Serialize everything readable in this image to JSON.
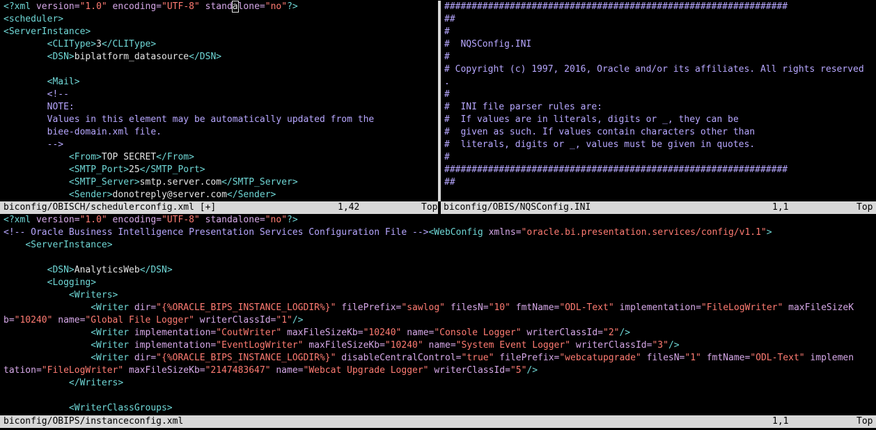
{
  "top_left": {
    "lines": [
      [
        {
          "c": "t",
          "v": "<?"
        },
        {
          "c": "t",
          "v": "xml "
        },
        {
          "c": "a",
          "v": "version="
        },
        {
          "c": "s",
          "v": "\"1.0\""
        },
        {
          "c": "a",
          "v": " encoding="
        },
        {
          "c": "s",
          "v": "\"UTF-8\""
        },
        {
          "c": "a",
          "v": " stand"
        },
        {
          "c": "cursor",
          "v": "a"
        },
        {
          "c": "a",
          "v": "lone="
        },
        {
          "c": "s",
          "v": "\"no\""
        },
        {
          "c": "t",
          "v": "?>"
        }
      ],
      [
        {
          "c": "t",
          "v": "<scheduler>"
        }
      ],
      [
        {
          "c": "t",
          "v": "<ServerInstance>"
        }
      ],
      [
        {
          "c": "w",
          "v": "        "
        },
        {
          "c": "t",
          "v": "<CLIType>"
        },
        {
          "c": "w",
          "v": "3"
        },
        {
          "c": "t",
          "v": "</CLIType>"
        }
      ],
      [
        {
          "c": "w",
          "v": "        "
        },
        {
          "c": "t",
          "v": "<DSN>"
        },
        {
          "c": "w",
          "v": "biplatform_datasource"
        },
        {
          "c": "t",
          "v": "</DSN>"
        }
      ],
      [],
      [
        {
          "c": "w",
          "v": "        "
        },
        {
          "c": "t",
          "v": "<Mail>"
        }
      ],
      [
        {
          "c": "w",
          "v": "        "
        },
        {
          "c": "x",
          "v": "<!--"
        }
      ],
      [
        {
          "c": "w",
          "v": "        "
        },
        {
          "c": "x",
          "v": "NOTE:"
        }
      ],
      [
        {
          "c": "w",
          "v": "        "
        },
        {
          "c": "x",
          "v": "Values in this element may be automatically updated from the"
        }
      ],
      [
        {
          "c": "w",
          "v": "        "
        },
        {
          "c": "x",
          "v": "biee-domain.xml file."
        }
      ],
      [
        {
          "c": "w",
          "v": "        "
        },
        {
          "c": "x",
          "v": "-->"
        }
      ],
      [
        {
          "c": "w",
          "v": "            "
        },
        {
          "c": "t",
          "v": "<From>"
        },
        {
          "c": "w",
          "v": "TOP SECRET"
        },
        {
          "c": "t",
          "v": "</From>"
        }
      ],
      [
        {
          "c": "w",
          "v": "            "
        },
        {
          "c": "t",
          "v": "<SMTP_Port>"
        },
        {
          "c": "w",
          "v": "25"
        },
        {
          "c": "t",
          "v": "</SMTP_Port>"
        }
      ],
      [
        {
          "c": "w",
          "v": "            "
        },
        {
          "c": "t",
          "v": "<SMTP_Server>"
        },
        {
          "c": "w",
          "v": "smtp.server.com"
        },
        {
          "c": "t",
          "v": "</SMTP_Server>"
        }
      ],
      [
        {
          "c": "w",
          "v": "            "
        },
        {
          "c": "t",
          "v": "<Sender>"
        },
        {
          "c": "w",
          "v": "donotreply@server.com"
        },
        {
          "c": "t",
          "v": "</Sender>"
        }
      ]
    ],
    "status": {
      "file": "biconfig/OBISCH/schedulerconfig.xml [+]",
      "pos": "1,42",
      "scroll": "Top"
    }
  },
  "top_right": {
    "lines": [
      [
        {
          "c": "x",
          "v": "###############################################################"
        }
      ],
      [
        {
          "c": "x",
          "v": "##"
        }
      ],
      [
        {
          "c": "x",
          "v": "#"
        }
      ],
      [
        {
          "c": "x",
          "v": "#  NQSConfig.INI"
        }
      ],
      [
        {
          "c": "x",
          "v": "#"
        }
      ],
      [
        {
          "c": "x",
          "v": "# Copyright (c) 1997, 2016, Oracle and/or its affiliates. All rights reserved"
        }
      ],
      [
        {
          "c": "x",
          "v": "."
        }
      ],
      [
        {
          "c": "x",
          "v": "#"
        }
      ],
      [
        {
          "c": "x",
          "v": "#  INI file parser rules are:"
        }
      ],
      [
        {
          "c": "x",
          "v": "#  If values are in literals, digits or _, they can be"
        }
      ],
      [
        {
          "c": "x",
          "v": "#  given as such. If values contain characters other than"
        }
      ],
      [
        {
          "c": "x",
          "v": "#  literals, digits or _, values must be given in quotes."
        }
      ],
      [
        {
          "c": "x",
          "v": "#"
        }
      ],
      [
        {
          "c": "x",
          "v": "###############################################################"
        }
      ],
      [
        {
          "c": "x",
          "v": "##"
        }
      ]
    ],
    "status": {
      "file": "biconfig/OBIS/NQSConfig.INI",
      "pos": "1,1",
      "scroll": "Top"
    }
  },
  "bottom": {
    "lines": [
      [
        {
          "c": "t",
          "v": "<?"
        },
        {
          "c": "t",
          "v": "xml "
        },
        {
          "c": "a",
          "v": "version="
        },
        {
          "c": "s",
          "v": "\"1.0\""
        },
        {
          "c": "a",
          "v": " encoding="
        },
        {
          "c": "s",
          "v": "\"UTF-8\""
        },
        {
          "c": "a",
          "v": " standalone="
        },
        {
          "c": "s",
          "v": "\"no\""
        },
        {
          "c": "t",
          "v": "?>"
        }
      ],
      [
        {
          "c": "x",
          "v": "<!-- Oracle Business Intelligence Presentation Services Configuration File -->"
        },
        {
          "c": "t",
          "v": "<WebConfig "
        },
        {
          "c": "a",
          "v": "xmlns="
        },
        {
          "c": "s",
          "v": "\"oracle.bi.presentation.services/config/v1.1\""
        },
        {
          "c": "t",
          "v": ">"
        }
      ],
      [
        {
          "c": "w",
          "v": "    "
        },
        {
          "c": "t",
          "v": "<ServerInstance>"
        }
      ],
      [],
      [
        {
          "c": "w",
          "v": "        "
        },
        {
          "c": "t",
          "v": "<DSN>"
        },
        {
          "c": "w",
          "v": "AnalyticsWeb"
        },
        {
          "c": "t",
          "v": "</DSN>"
        }
      ],
      [
        {
          "c": "w",
          "v": "        "
        },
        {
          "c": "t",
          "v": "<Logging>"
        }
      ],
      [
        {
          "c": "w",
          "v": "            "
        },
        {
          "c": "t",
          "v": "<Writers>"
        }
      ],
      [
        {
          "c": "w",
          "v": "                "
        },
        {
          "c": "t",
          "v": "<Writer "
        },
        {
          "c": "a",
          "v": "dir="
        },
        {
          "c": "s",
          "v": "\"{%ORACLE_BIPS_INSTANCE_LOGDIR%}\""
        },
        {
          "c": "a",
          "v": " filePrefix="
        },
        {
          "c": "s",
          "v": "\"sawlog\""
        },
        {
          "c": "a",
          "v": " filesN="
        },
        {
          "c": "s",
          "v": "\"10\""
        },
        {
          "c": "a",
          "v": " fmtName="
        },
        {
          "c": "s",
          "v": "\"ODL-Text\""
        },
        {
          "c": "a",
          "v": " implementation="
        },
        {
          "c": "s",
          "v": "\"FileLogWriter\""
        },
        {
          "c": "a",
          "v": " maxFileSizeK"
        }
      ],
      [
        {
          "c": "a",
          "v": "b="
        },
        {
          "c": "s",
          "v": "\"10240\""
        },
        {
          "c": "a",
          "v": " name="
        },
        {
          "c": "s",
          "v": "\"Global File Logger\""
        },
        {
          "c": "a",
          "v": " writerClassId="
        },
        {
          "c": "s",
          "v": "\"1\""
        },
        {
          "c": "t",
          "v": "/>"
        }
      ],
      [
        {
          "c": "w",
          "v": "                "
        },
        {
          "c": "t",
          "v": "<Writer "
        },
        {
          "c": "a",
          "v": "implementation="
        },
        {
          "c": "s",
          "v": "\"CoutWriter\""
        },
        {
          "c": "a",
          "v": " maxFileSizeKb="
        },
        {
          "c": "s",
          "v": "\"10240\""
        },
        {
          "c": "a",
          "v": " name="
        },
        {
          "c": "s",
          "v": "\"Console Logger\""
        },
        {
          "c": "a",
          "v": " writerClassId="
        },
        {
          "c": "s",
          "v": "\"2\""
        },
        {
          "c": "t",
          "v": "/>"
        }
      ],
      [
        {
          "c": "w",
          "v": "                "
        },
        {
          "c": "t",
          "v": "<Writer "
        },
        {
          "c": "a",
          "v": "implementation="
        },
        {
          "c": "s",
          "v": "\"EventLogWriter\""
        },
        {
          "c": "a",
          "v": " maxFileSizeKb="
        },
        {
          "c": "s",
          "v": "\"10240\""
        },
        {
          "c": "a",
          "v": " name="
        },
        {
          "c": "s",
          "v": "\"System Event Logger\""
        },
        {
          "c": "a",
          "v": " writerClassId="
        },
        {
          "c": "s",
          "v": "\"3\""
        },
        {
          "c": "t",
          "v": "/>"
        }
      ],
      [
        {
          "c": "w",
          "v": "                "
        },
        {
          "c": "t",
          "v": "<Writer "
        },
        {
          "c": "a",
          "v": "dir="
        },
        {
          "c": "s",
          "v": "\"{%ORACLE_BIPS_INSTANCE_LOGDIR%}\""
        },
        {
          "c": "a",
          "v": " disableCentralControl="
        },
        {
          "c": "s",
          "v": "\"true\""
        },
        {
          "c": "a",
          "v": " filePrefix="
        },
        {
          "c": "s",
          "v": "\"webcatupgrade\""
        },
        {
          "c": "a",
          "v": " filesN="
        },
        {
          "c": "s",
          "v": "\"1\""
        },
        {
          "c": "a",
          "v": " fmtName="
        },
        {
          "c": "s",
          "v": "\"ODL-Text\""
        },
        {
          "c": "a",
          "v": " implemen"
        }
      ],
      [
        {
          "c": "a",
          "v": "tation="
        },
        {
          "c": "s",
          "v": "\"FileLogWriter\""
        },
        {
          "c": "a",
          "v": " maxFileSizeKb="
        },
        {
          "c": "s",
          "v": "\"2147483647\""
        },
        {
          "c": "a",
          "v": " name="
        },
        {
          "c": "s",
          "v": "\"Webcat Upgrade Logger\""
        },
        {
          "c": "a",
          "v": " writerClassId="
        },
        {
          "c": "s",
          "v": "\"5\""
        },
        {
          "c": "t",
          "v": "/>"
        }
      ],
      [
        {
          "c": "w",
          "v": "            "
        },
        {
          "c": "t",
          "v": "</Writers>"
        }
      ],
      [],
      [
        {
          "c": "w",
          "v": "            "
        },
        {
          "c": "t",
          "v": "<WriterClassGroups>"
        }
      ]
    ],
    "status": {
      "file": "biconfig/OBIPS/instanceconfig.xml",
      "pos": "1,1",
      "scroll": "Top"
    }
  }
}
